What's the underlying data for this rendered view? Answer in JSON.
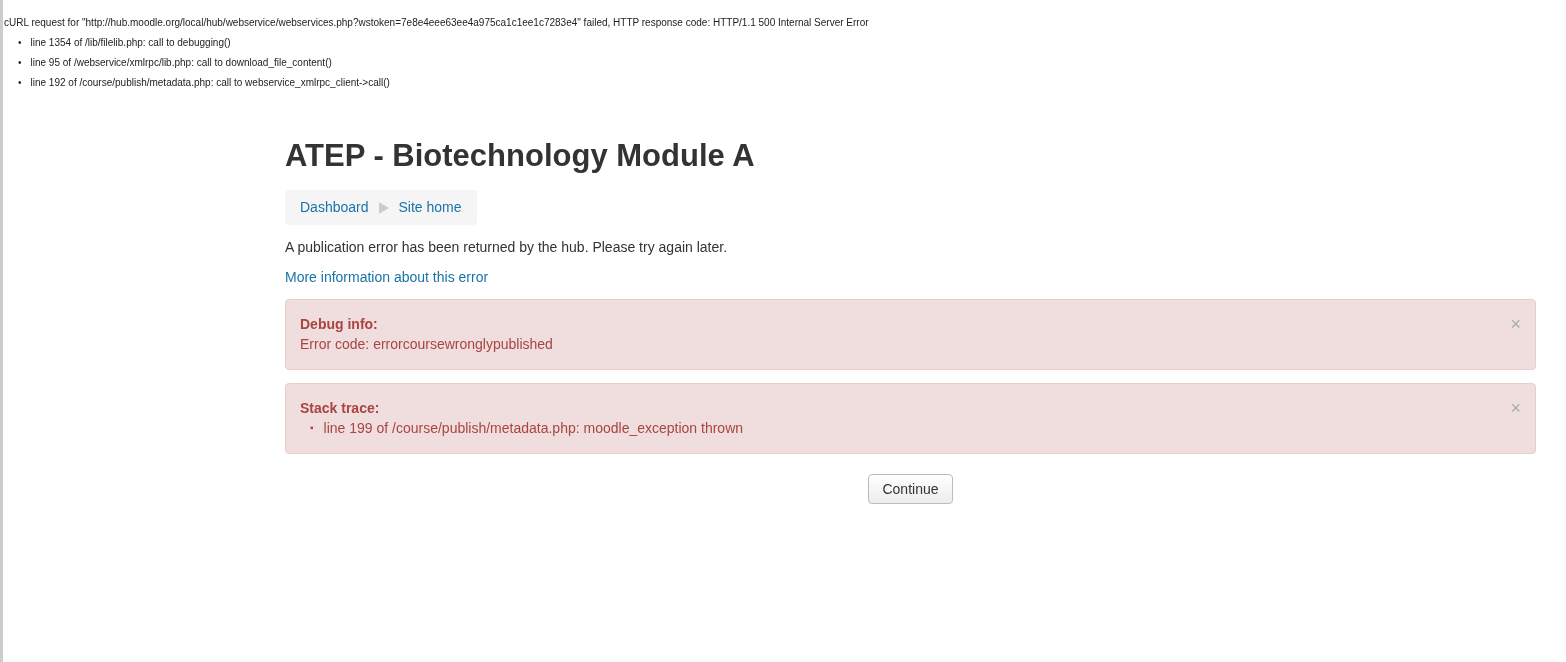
{
  "debug_output": {
    "message": "cURL request for \"http://hub.moodle.org/local/hub/webservice/webservices.php?wstoken=7e8e4eee63ee4a975ca1c1ee1c7283e4\" failed, HTTP response code: HTTP/1.1 500 Internal Server Error",
    "trace": [
      {
        "bullet": "•",
        "text": "line 1354 of /lib/filelib.php: call to debugging()"
      },
      {
        "bullet": "•",
        "text": "line 95 of /webservice/xmlrpc/lib.php: call to download_file_content()"
      },
      {
        "bullet": "•",
        "text": "line 192 of /course/publish/metadata.php: call to webservice_xmlrpc_client->call()"
      }
    ]
  },
  "page_title": "ATEP - Biotechnology Module A",
  "breadcrumb": [
    "Dashboard",
    "Site home"
  ],
  "message": "A publication error has been returned by the hub. Please try again later.",
  "more_info_link": "More information about this error",
  "alerts": [
    {
      "heading": "Debug info:",
      "kind": "text",
      "lines": [
        {
          "text": "Error code: errorcoursewronglypublished"
        }
      ],
      "close": "×"
    },
    {
      "heading": "Stack trace:",
      "kind": "list",
      "lines": [
        {
          "bullet": "▪",
          "text": "line 199 of /course/publish/metadata.php: moodle_exception thrown"
        }
      ],
      "close": "×"
    }
  ],
  "continue_button": "Continue"
}
